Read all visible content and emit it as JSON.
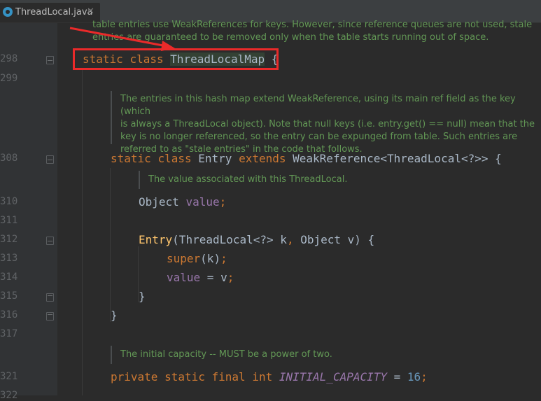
{
  "tab": {
    "filename": "ThreadLocal.java",
    "close": "✕"
  },
  "top_doc": {
    "line1": "table entries use WeakReferences for keys. However, since reference queues are not used, stale",
    "line2": "entries are guaranteed to be removed only when the table starts running out of space."
  },
  "lines": {
    "l298": "298",
    "l299": "299",
    "l308": "308",
    "l310": "310",
    "l311": "311",
    "l312": "312",
    "l313": "313",
    "l314": "314",
    "l315": "315",
    "l316": "316",
    "l317": "317",
    "l321": "321",
    "l322": "322"
  },
  "code": {
    "static": "static",
    "class": "class",
    "map_name": "ThreadLocalMap",
    "open_brace": "{",
    "entry": "Entry",
    "extends": "extends",
    "weakref": "WeakReference<ThreadLocal<?>> {",
    "object": "Object ",
    "value": "value",
    "semi": ";",
    "entry_ctor": "Entry",
    "ctor_params_a": "(ThreadLocal<?> k",
    "comma": ",",
    "ctor_params_b": " Object v) {",
    "super": "super",
    "super_args": "(k)",
    "value2": "value",
    "assign": " = v",
    "close_brace": "}",
    "private": "private",
    "final": "final",
    "int": "int",
    "init_cap": "INITIAL_CAPACITY",
    "eq": " = ",
    "sixteen": "16"
  },
  "doc1": {
    "line1": "The entries in this hash map extend WeakReference, using its main ref field as the key (which",
    "line2": "is always a ThreadLocal object). Note that null keys (i.e. entry.get() == null) mean that the",
    "line3": "key is no longer referenced, so the entry can be expunged from table. Such entries are",
    "line4": "referred to as \"stale entries\" in the code that follows."
  },
  "doc2": "The value associated with this ThreadLocal.",
  "doc3": "The initial capacity -- MUST be a power of two.",
  "colors": {
    "highlight_box": "#ea2a2a",
    "keyword": "#cc7832",
    "doc_comment": "#629755"
  }
}
